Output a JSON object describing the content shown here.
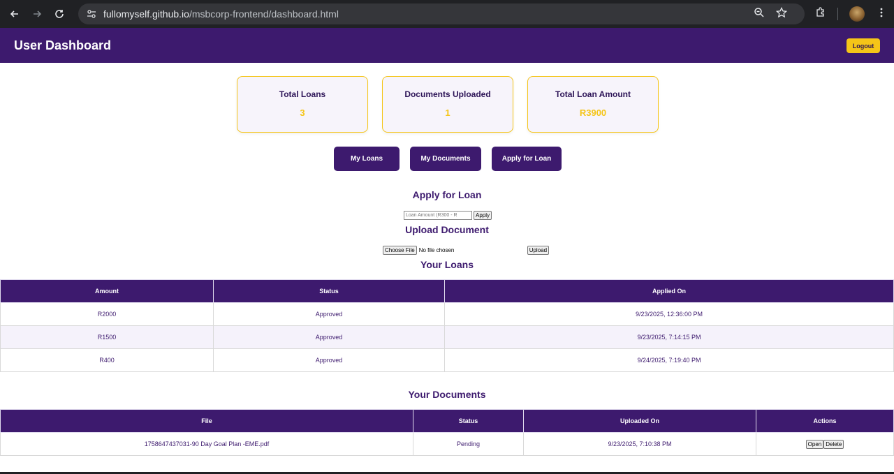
{
  "browser": {
    "url_host": "fullomyself.github.io",
    "url_path": "/msbcorp-frontend/dashboard.html"
  },
  "header": {
    "title": "User Dashboard",
    "logout_label": "Logout"
  },
  "stats": [
    {
      "label": "Total Loans",
      "value": "3"
    },
    {
      "label": "Documents Uploaded",
      "value": "1"
    },
    {
      "label": "Total Loan Amount",
      "value": "R3900"
    }
  ],
  "nav_buttons": [
    "My Loans",
    "My Documents",
    "Apply for Loan"
  ],
  "apply": {
    "title": "Apply for Loan",
    "amount_placeholder": "Loan Amount (R300 - R",
    "submit_label": "Apply"
  },
  "upload": {
    "title": "Upload Document",
    "choose_label": "Choose File",
    "file_status": "No file chosen",
    "submit_label": "Upload"
  },
  "loans": {
    "title": "Your Loans",
    "columns": [
      "Amount",
      "Status",
      "Applied On"
    ],
    "rows": [
      [
        "R2000",
        "Approved",
        "9/23/2025, 12:36:00 PM"
      ],
      [
        "R1500",
        "Approved",
        "9/23/2025, 7:14:15 PM"
      ],
      [
        "R400",
        "Approved",
        "9/24/2025, 7:19:40 PM"
      ]
    ]
  },
  "documents": {
    "title": "Your Documents",
    "columns": [
      "File",
      "Status",
      "Uploaded On",
      "Actions"
    ],
    "rows": [
      {
        "file": "1758647437031-90 Day Goal Plan -EME.pdf",
        "status": "Pending",
        "uploaded_on": "9/23/2025, 7:10:38 PM",
        "open_label": "Open",
        "delete_label": "Delete"
      }
    ]
  },
  "colors": {
    "primary": "#3d1a6e",
    "accent": "#f5c518"
  }
}
